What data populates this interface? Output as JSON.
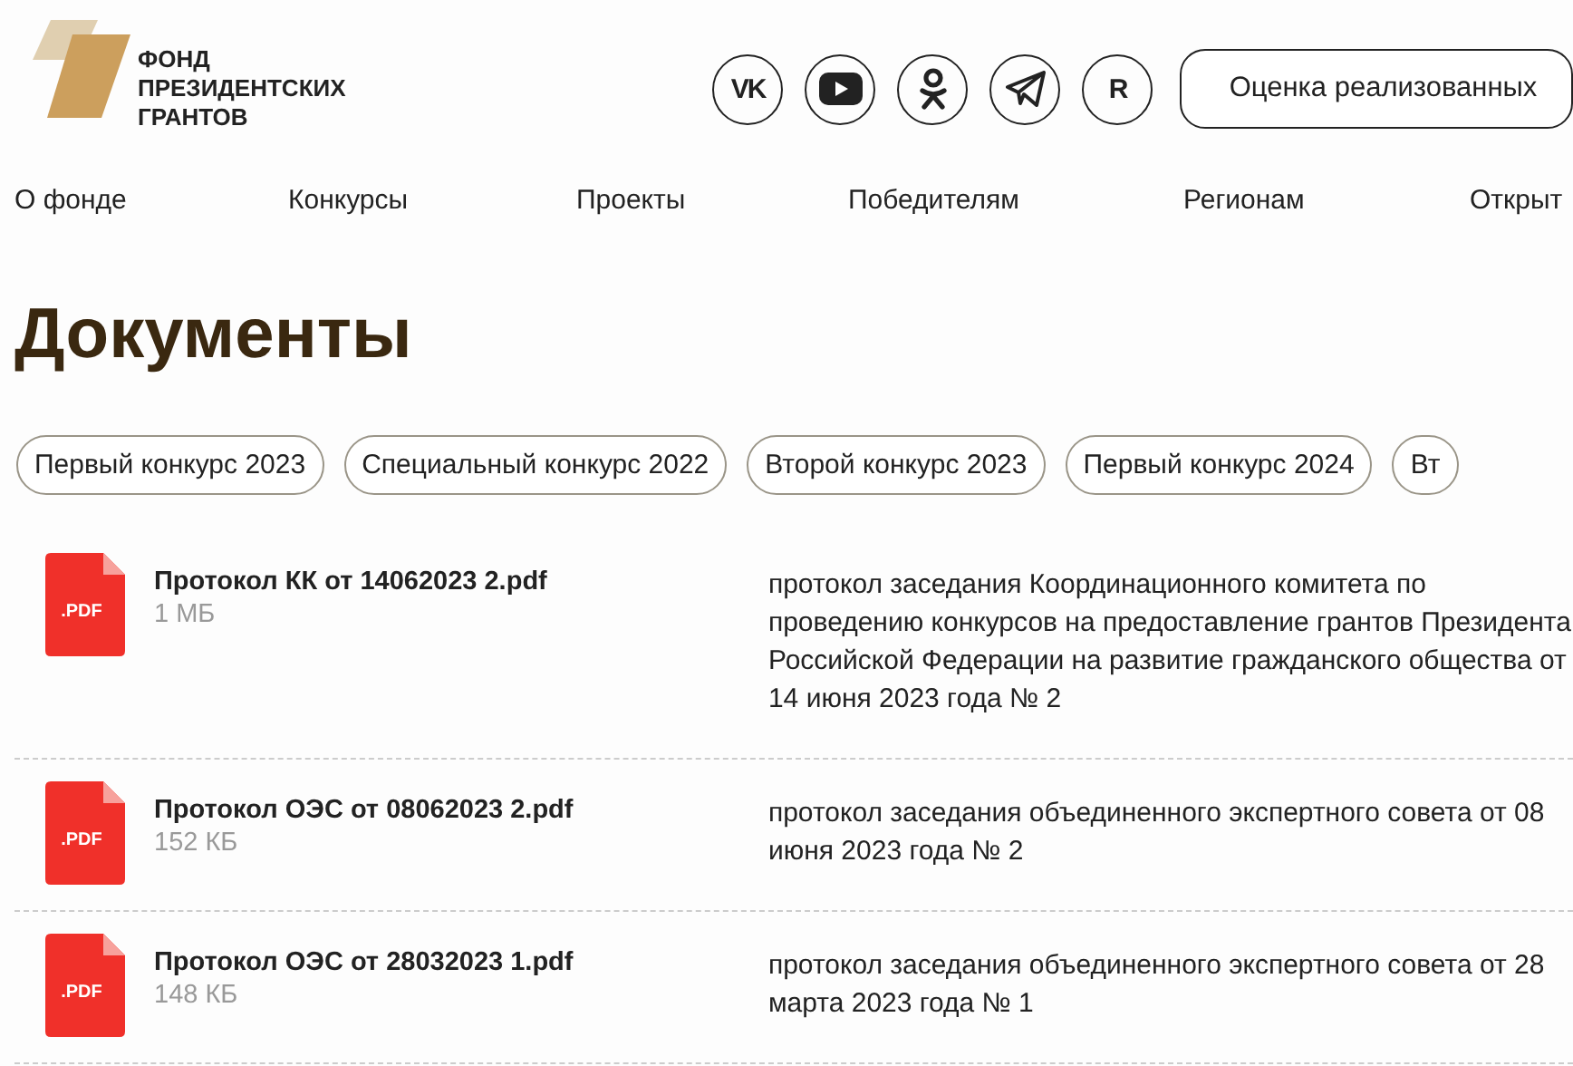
{
  "logo": {
    "lines": [
      "ФОНД",
      "ПРЕЗИДЕНТСКИХ",
      "ГРАНТОВ"
    ]
  },
  "social": [
    {
      "kind": "text",
      "glyph": "VK"
    },
    {
      "kind": "play"
    },
    {
      "kind": "figure"
    },
    {
      "kind": "plane"
    },
    {
      "kind": "text",
      "glyph": "R"
    }
  ],
  "header_button": "Оценка реализованных",
  "nav": [
    "О фонде",
    "Конкурсы",
    "Проекты",
    "Победителям",
    "Регионам",
    "Открыт"
  ],
  "title": "Документы",
  "filters": [
    "Первый конкурс 2023",
    "Специальный конкурс 2022",
    "Второй конкурс 2023",
    "Первый конкурс 2024",
    "Вт"
  ],
  "documents": [
    {
      "icon_label": ".PDF",
      "name": "Протокол КК от 14062023 2.pdf",
      "size": "1 МБ",
      "description": "протокол заседания Координационного комитета по проведению конкурсов на предоставление грантов Президента Российской Федерации на развитие гражданского общества от 14 июня 2023 года № 2"
    },
    {
      "icon_label": ".PDF",
      "name": "Протокол ОЭС от 08062023 2.pdf",
      "size": "152 КБ",
      "description": "протокол заседания объединенного экспертного совета от 08 июня 2023 года № 2"
    },
    {
      "icon_label": ".PDF",
      "name": "Протокол ОЭС от 28032023 1.pdf",
      "size": "148 КБ",
      "description": "протокол заседания объединенного экспертного совета от 28 марта 2023 года № 1"
    }
  ]
}
